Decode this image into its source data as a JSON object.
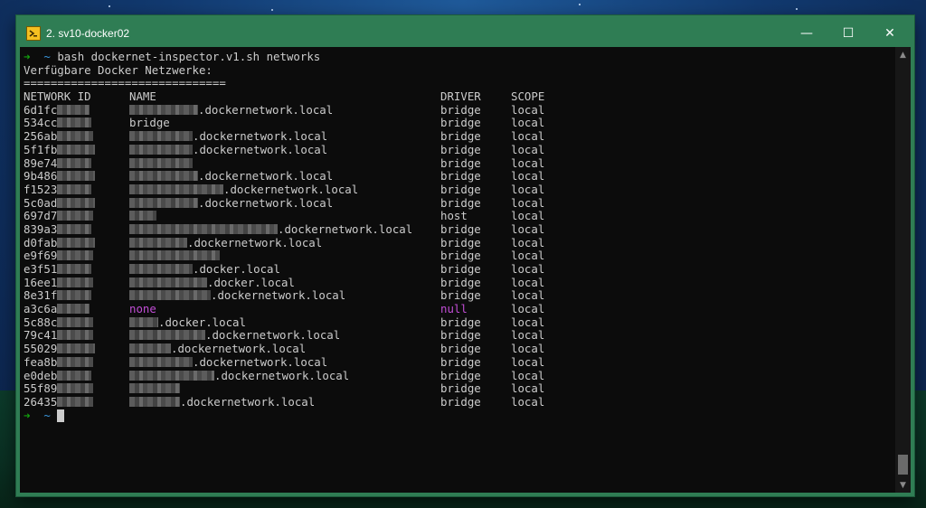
{
  "window": {
    "title": "2. sv10-docker02",
    "controls": {
      "minimize": "—",
      "maximize": "☐",
      "close": "✕"
    }
  },
  "terminal": {
    "prompt_symbol": "➜",
    "prompt_dir": "~",
    "command": "bash dockernet-inspector.v1.sh networks",
    "heading": "Verfügbare Docker Netzwerke:",
    "separator": "==============================",
    "headers": {
      "id": "NETWORK ID",
      "name": "NAME",
      "driver": "DRIVER",
      "scope": "SCOPE"
    },
    "rows": [
      {
        "id": "6d1fc",
        "name": ".dockernetwork.local",
        "driver": "bridge",
        "scope": "local"
      },
      {
        "id": "534cc",
        "name": "bridge",
        "driver": "bridge",
        "scope": "local"
      },
      {
        "id": "256ab",
        "name": ".dockernetwork.local",
        "driver": "bridge",
        "scope": "local"
      },
      {
        "id": "5f1fb",
        "name": ".dockernetwork.local",
        "driver": "bridge",
        "scope": "local"
      },
      {
        "id": "89e74",
        "name": "",
        "driver": "bridge",
        "scope": "local"
      },
      {
        "id": "9b486",
        "name": ".dockernetwork.local",
        "driver": "bridge",
        "scope": "local"
      },
      {
        "id": "f1523",
        "name": ".dockernetwork.local",
        "driver": "bridge",
        "scope": "local"
      },
      {
        "id": "5c0ad",
        "name": ".dockernetwork.local",
        "driver": "bridge",
        "scope": "local"
      },
      {
        "id": "697d7",
        "name": "",
        "driver": "host",
        "scope": "local"
      },
      {
        "id": "839a3",
        "name": ".dockernetwork.local",
        "driver": "bridge",
        "scope": "local"
      },
      {
        "id": "d0fab",
        "name": ".dockernetwork.local",
        "driver": "bridge",
        "scope": "local"
      },
      {
        "id": "e9f69",
        "name": "",
        "driver": "bridge",
        "scope": "local"
      },
      {
        "id": "e3f51",
        "name": ".docker.local",
        "driver": "bridge",
        "scope": "local"
      },
      {
        "id": "16ee1",
        "name": ".docker.local",
        "driver": "bridge",
        "scope": "local"
      },
      {
        "id": "8e31f",
        "name": ".dockernetwork.local",
        "driver": "bridge",
        "scope": "local"
      },
      {
        "id": "a3c6a",
        "name": "none",
        "driver": "null",
        "scope": "local"
      },
      {
        "id": "5c88c",
        "name": ".docker.local",
        "driver": "bridge",
        "scope": "local"
      },
      {
        "id": "79c41",
        "name": ".dockernetwork.local",
        "driver": "bridge",
        "scope": "local"
      },
      {
        "id": "55029",
        "name": ".dockernetwork.local",
        "driver": "bridge",
        "scope": "local"
      },
      {
        "id": "fea8b",
        "name": ".dockernetwork.local",
        "driver": "bridge",
        "scope": "local"
      },
      {
        "id": "e0deb",
        "name": ".dockernetwork.local",
        "driver": "bridge",
        "scope": "local"
      },
      {
        "id": "55f89",
        "name": "",
        "driver": "bridge",
        "scope": "local"
      },
      {
        "id": "26435",
        "name": ".dockernetwork.local",
        "driver": "bridge",
        "scope": "local"
      }
    ]
  },
  "colors": {
    "titlebar": "#2f7d54",
    "terminal_bg": "#0c0c0c",
    "text": "#cccccc",
    "prompt_arrow": "#13a10e",
    "highlight": "#c24dd6"
  }
}
